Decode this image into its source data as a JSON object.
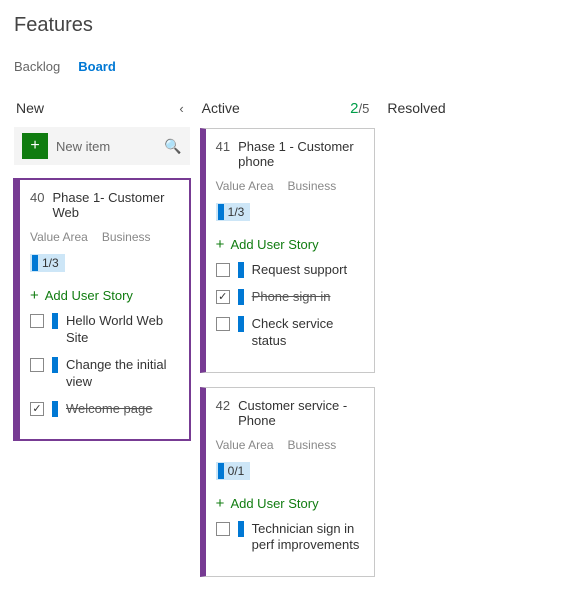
{
  "header": {
    "title": "Features"
  },
  "tabs": {
    "backlog": "Backlog",
    "board": "Board",
    "active": "board"
  },
  "columns": {
    "new": {
      "name": "New"
    },
    "active": {
      "name": "Active",
      "count_current": "2",
      "count_limit": "/5"
    },
    "resolved": {
      "name": "Resolved"
    }
  },
  "newItem": {
    "placeholder": "New item"
  },
  "meta_labels": {
    "value_area": "Value Area",
    "business": "Business",
    "add_user_story": "Add User Story"
  },
  "cards": {
    "c40": {
      "id": "40",
      "title": "Phase 1- Customer Web",
      "progress": "1/3",
      "stories": [
        {
          "label": "Hello World Web Site",
          "done": false
        },
        {
          "label": "Change the initial view",
          "done": false
        },
        {
          "label": "Welcome page",
          "done": true
        }
      ]
    },
    "c41": {
      "id": "41",
      "title": "Phase 1 - Customer phone",
      "progress": "1/3",
      "stories": [
        {
          "label": "Request support",
          "done": false
        },
        {
          "label": "Phone sign in",
          "done": true
        },
        {
          "label": "Check service status",
          "done": false
        }
      ]
    },
    "c42": {
      "id": "42",
      "title": "Customer service - Phone",
      "progress": "0/1",
      "stories": [
        {
          "label": "Technician sign in perf improvements",
          "done": false
        }
      ]
    }
  }
}
